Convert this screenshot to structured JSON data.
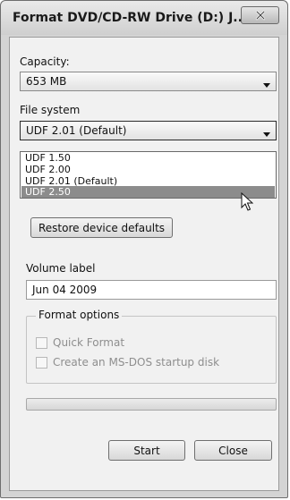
{
  "window": {
    "title": "Format DVD/CD-RW Drive (D:) J..."
  },
  "capacity": {
    "label": "Capacity:",
    "value": "653 MB"
  },
  "file_system": {
    "label": "File system",
    "value": "UDF 2.01 (Default)",
    "options": [
      "UDF 1.50",
      "UDF 2.00",
      "UDF 2.01 (Default)",
      "UDF 2.50"
    ],
    "highlighted_option": "UDF 2.50"
  },
  "restore_button": {
    "label": "Restore device defaults"
  },
  "volume_label": {
    "label": "Volume label",
    "value": "Jun 04 2009"
  },
  "format_options": {
    "title": "Format options",
    "quick_format": {
      "label": "Quick Format",
      "checked": false,
      "enabled": false
    },
    "msdos_disk": {
      "label": "Create an MS-DOS startup disk",
      "checked": false,
      "enabled": false
    }
  },
  "progress": {
    "value": 0
  },
  "buttons": {
    "start": "Start",
    "close": "Close"
  },
  "icons": {
    "close": "close-icon",
    "dropdown": "chevron-down-icon",
    "cursor": "mouse-pointer-icon"
  }
}
